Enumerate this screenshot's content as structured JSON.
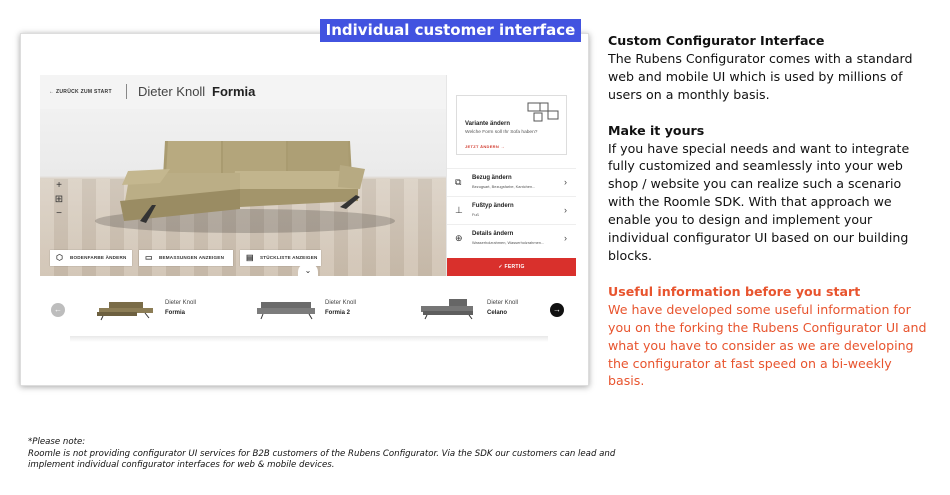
{
  "banner": {
    "label": "Individual customer interface"
  },
  "configurator": {
    "back_label": "ZURÜCK ZUM START",
    "brand": "Dieter Knoll",
    "model": "Formia",
    "zoom": {
      "in": "+",
      "fit": "⊞",
      "out": "−"
    },
    "actions": [
      {
        "label": "BODENFARBE ÄNDERN",
        "icon": "floor-icon"
      },
      {
        "label": "BEMASSUNGEN ANZEIGEN",
        "icon": "ruler-icon"
      },
      {
        "label": "STÜCKLISTE ANZEIGEN",
        "icon": "list-icon"
      }
    ],
    "variant": {
      "title": "Variante ändern",
      "subtitle": "Welche Form soll Ihr Sofa haben?",
      "link": "JETZT ÄNDERN →"
    },
    "menu": [
      {
        "title": "Bezug ändern",
        "subtitle": "Bezugsart, Bezugsfarbe, Kantchen...",
        "icon": "fabric-icon"
      },
      {
        "title": "Fußtyp ändern",
        "subtitle": "Fuß",
        "icon": "foot-icon"
      },
      {
        "title": "Details ändern",
        "subtitle": "Wasserholzrahmen, Wasserholzrahmen...",
        "icon": "details-icon"
      }
    ],
    "done_label": "✓ FERTIG",
    "products": [
      {
        "brand": "Dieter Knoll",
        "name": "Formia"
      },
      {
        "brand": "Dieter Knoll",
        "name": "Formia 2"
      },
      {
        "brand": "Dieter Knoll",
        "name": "Celano"
      }
    ]
  },
  "info": {
    "heading1": "Custom Configurator Interface",
    "para1": "The Rubens Configurator comes with a standard web and mobile UI which is used by millions of users on a monthly basis.",
    "heading2": "Make it yours",
    "para2": "If you have special needs and want to integrate fully customized and seamlessly into your web shop / website you can realize such a scenario with the Roomle SDK. With that approach we enable you to design and implement  your individual configurator UI based on our building blocks.",
    "heading3": "Useful information before you start",
    "para3": "We have developed some useful information for you on the forking the Rubens Configurator UI and what you have to consider as we are developing the configurator at fast speed on a bi-weekly basis."
  },
  "footnote": {
    "title": "*Please note:",
    "body": "Roomle is not providing configurator UI services for B2B customers of the Rubens Configurator. Via the SDK our customers can lead and implement individual configurator interfaces for web & mobile devices."
  },
  "colors": {
    "banner": "#4253e0",
    "accent_red": "#d9302c",
    "info_red": "#e8542e",
    "sofa": "#b3a67d"
  }
}
